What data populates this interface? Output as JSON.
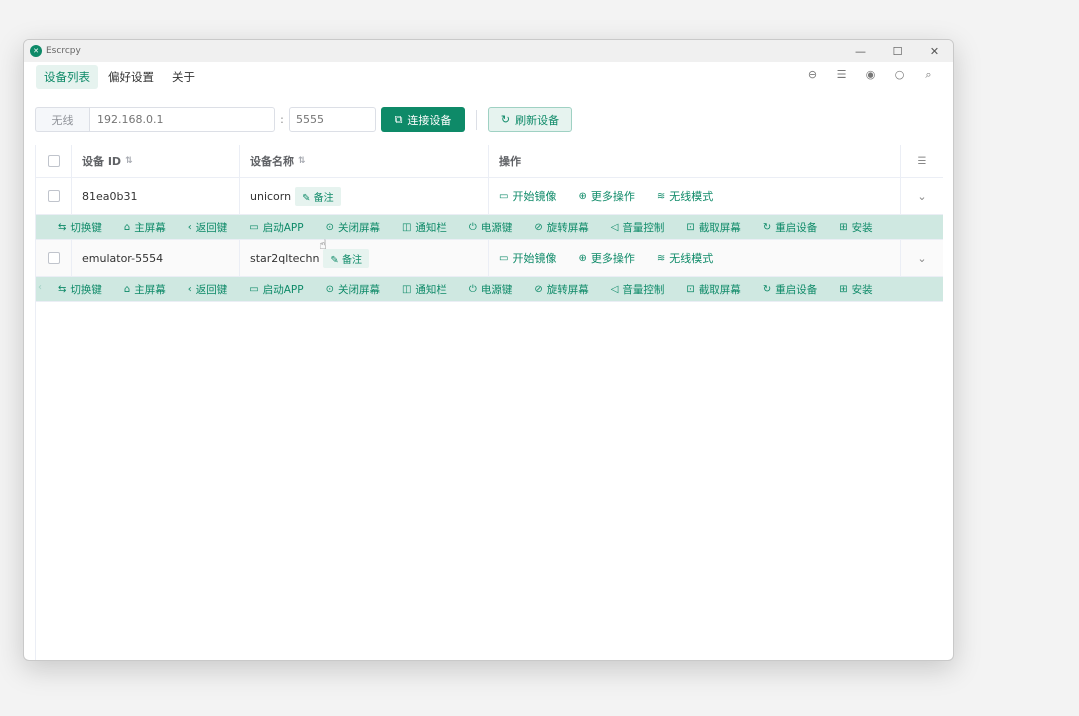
{
  "window": {
    "title": "Escrcpy",
    "minimize": "—",
    "maximize": "☐",
    "close": "✕"
  },
  "menu": {
    "items": [
      {
        "label": "设备列表",
        "active": true
      },
      {
        "label": "偏好设置",
        "active": false
      },
      {
        "label": "关于",
        "active": false
      }
    ],
    "right_icons": [
      "⊖",
      "☰",
      "◉",
      "○",
      "⌕"
    ]
  },
  "connect": {
    "prefix": "无线",
    "ip_placeholder": "192.168.0.1",
    "colon": ":",
    "port_placeholder": "5555",
    "connect_label": "连接设备",
    "refresh_label": "刷新设备"
  },
  "table": {
    "headers": {
      "id": "设备 ID",
      "name": "设备名称",
      "ops": "操作",
      "sort_icon": "⇅",
      "filter_icon": "☰"
    },
    "rows": [
      {
        "id": "81ea0b31",
        "name": "unicorn",
        "remark": "备注",
        "ops": [
          "开始镜像",
          "更多操作",
          "无线模式"
        ],
        "expand": "⌄"
      },
      {
        "id": "emulator-5554",
        "name": "star2qltechn",
        "remark": "备注",
        "ops": [
          "开始镜像",
          "更多操作",
          "无线模式"
        ],
        "expand": "⌄"
      }
    ],
    "op_icons": [
      "▭",
      "⊕",
      "≋"
    ],
    "actions": [
      "切换键",
      "主屏幕",
      "返回键",
      "启动APP",
      "关闭屏幕",
      "通知栏",
      "电源键",
      "旋转屏幕",
      "音量控制",
      "截取屏幕",
      "重启设备",
      "安装"
    ],
    "action_icons": [
      "⇆",
      "⌂",
      "‹",
      "▭",
      "⊙",
      "◫",
      "⏻",
      "⊘",
      "◁",
      "⊡",
      "↻",
      "⊞"
    ]
  },
  "colors": {
    "accent": "#0e8a68",
    "strip": "#cfe8e1"
  }
}
